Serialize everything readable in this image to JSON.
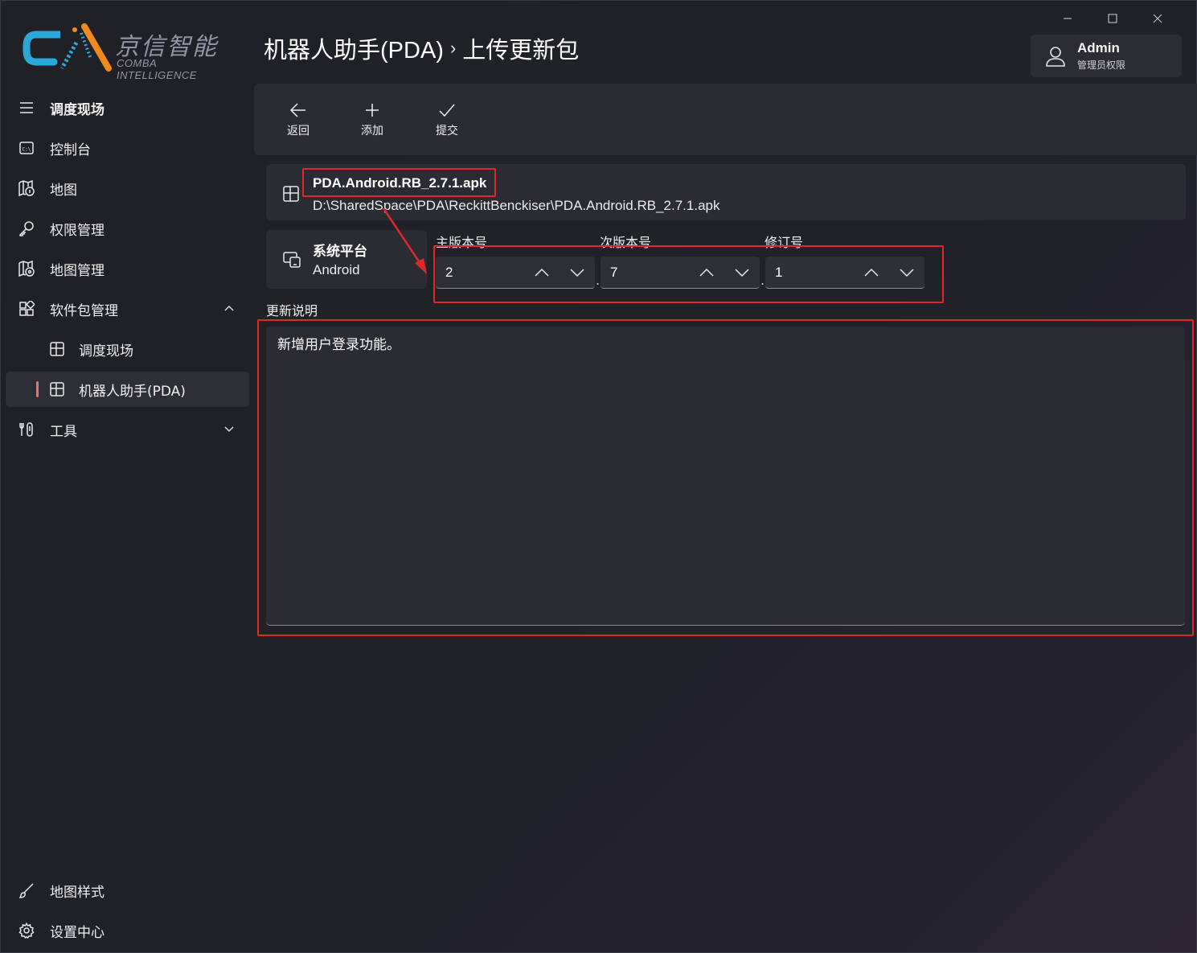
{
  "window": {
    "controls": [
      "minimize",
      "maximize",
      "close"
    ]
  },
  "logo": {
    "cn": "京信智能",
    "en": "COMBA INTELLIGENCE"
  },
  "breadcrumb": {
    "parent": "机器人助手(PDA)",
    "separator": "›",
    "current": "上传更新包"
  },
  "user": {
    "name": "Admin",
    "role": "管理员权限",
    "icon": "user-icon"
  },
  "sidebar": {
    "items": [
      {
        "label": "调度现场",
        "icon": "hamburger-icon"
      },
      {
        "label": "控制台",
        "icon": "console-icon"
      },
      {
        "label": "地图",
        "icon": "map-icon"
      },
      {
        "label": "权限管理",
        "icon": "key-icon"
      },
      {
        "label": "地图管理",
        "icon": "map-manage-icon"
      },
      {
        "label": "软件包管理",
        "icon": "package-icon"
      },
      {
        "label": "调度现场",
        "icon": "grid-icon"
      },
      {
        "label": "机器人助手(PDA)",
        "icon": "grid-icon"
      },
      {
        "label": "工具",
        "icon": "tools-icon"
      }
    ],
    "footer": [
      {
        "label": "地图样式",
        "icon": "brush-icon"
      },
      {
        "label": "设置中心",
        "icon": "gear-icon"
      }
    ]
  },
  "toolbar": {
    "back_label": "返回",
    "add_label": "添加",
    "submit_label": "提交"
  },
  "file": {
    "name": "PDA.Android.RB_2.7.1.apk",
    "path": "D:\\SharedSpace\\PDA\\ReckittBenckiser\\PDA.Android.RB_2.7.1.apk"
  },
  "platform": {
    "title": "系统平台",
    "value": "Android"
  },
  "version": {
    "major_label": "主版本号",
    "major_value": "2",
    "minor_label": "次版本号",
    "minor_value": "7",
    "revision_label": "修订号",
    "revision_value": "1",
    "dot": "."
  },
  "description": {
    "label": "更新说明",
    "text": "新增用户登录功能。"
  },
  "colors": {
    "background": "#1f2026",
    "card": "#2b2c33",
    "accent_pill": "#f26f6f",
    "annotation": "#e0282a",
    "logo_blue": "#2aa9d8",
    "logo_orange": "#f08a1c"
  }
}
